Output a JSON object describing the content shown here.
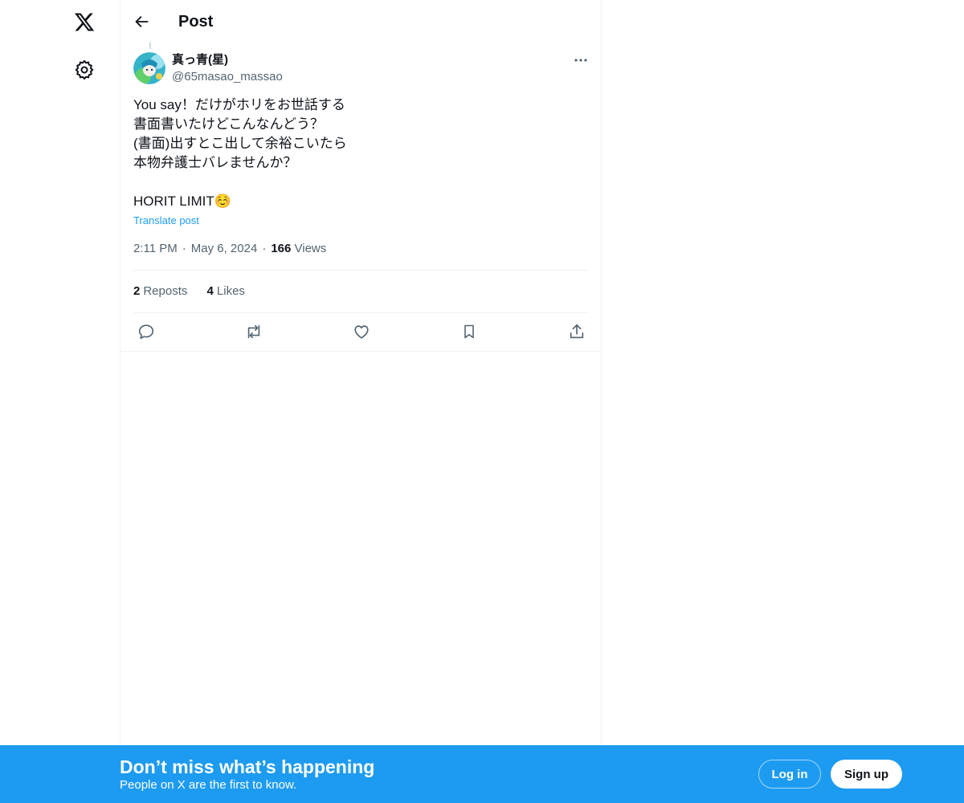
{
  "nav": {
    "logo_icon": "x-logo-icon",
    "settings_icon": "gear-icon"
  },
  "header": {
    "back_icon": "arrow-left-icon",
    "title": "Post"
  },
  "post": {
    "author": {
      "display_name": "真っ青(星)",
      "handle": "@65masao_massao"
    },
    "more_icon": "more-horizontal-icon",
    "text_lines": [
      "You say！だけがホリをお世話する",
      "書面書いたけどこんなんどう？",
      "(書面)出すとこ出して余裕こいたら",
      "本物弁護士バレませんか？",
      "",
      "HORIT LIMIT☺️"
    ],
    "translate_label": "Translate post",
    "time": "2:11 PM",
    "date": "May 6, 2024",
    "separator": "·",
    "views_count": "166",
    "views_label": "Views",
    "reposts_count": "2",
    "reposts_label": "Reposts",
    "likes_count": "4",
    "likes_label": "Likes"
  },
  "actions": {
    "reply_icon": "reply-icon",
    "repost_icon": "repost-icon",
    "like_icon": "heart-icon",
    "bookmark_icon": "bookmark-icon",
    "share_icon": "share-icon"
  },
  "banner": {
    "title": "Don’t miss what’s happening",
    "subtitle": "People on X are the first to know.",
    "login_label": "Log in",
    "signup_label": "Sign up"
  },
  "colors": {
    "accent": "#1d9bf0",
    "text_primary": "#0f1419",
    "text_secondary": "#536471",
    "border": "#eff3f4"
  }
}
